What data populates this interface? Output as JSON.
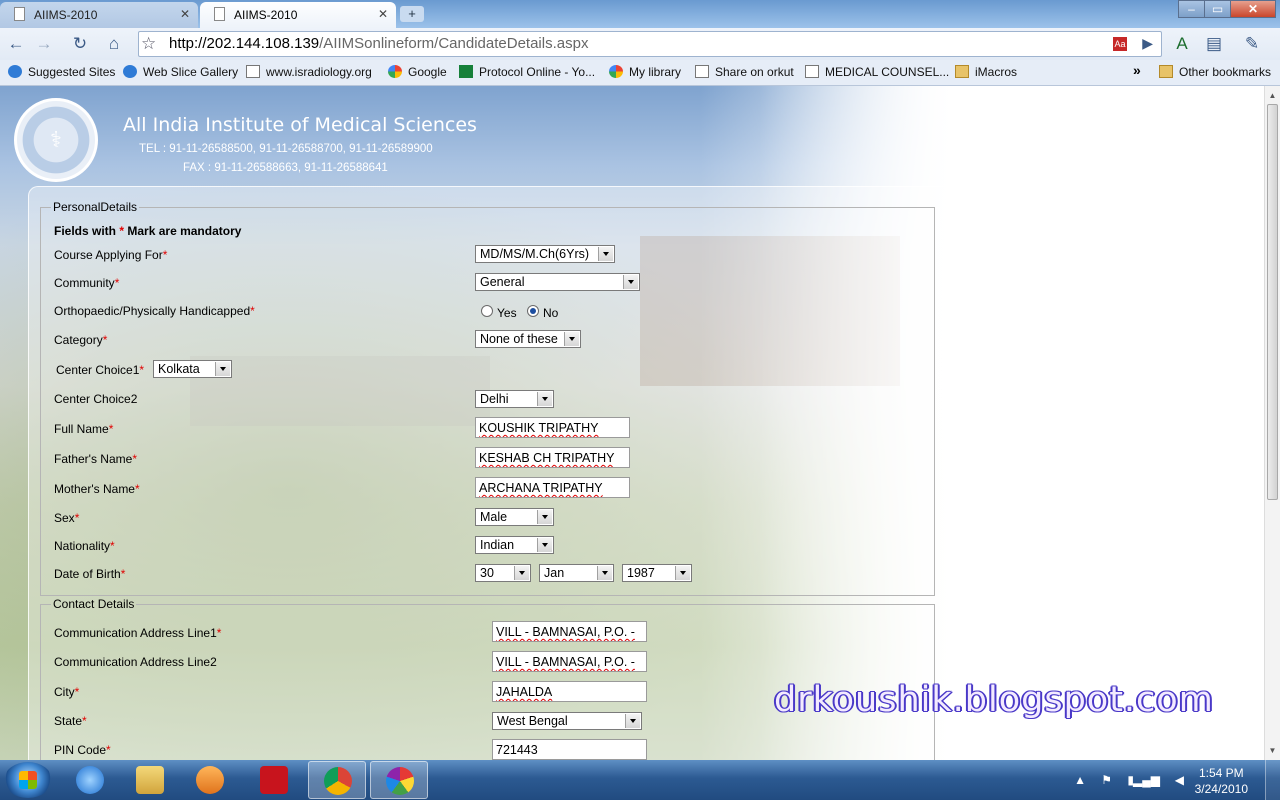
{
  "browser": {
    "tabs": [
      {
        "label": "AIIMS-2010",
        "active": false
      },
      {
        "label": "AIIMS-2010",
        "active": true
      }
    ],
    "window_buttons": {
      "minimize": "‒",
      "maximize": "▭",
      "close": "✕"
    },
    "url_host": "http://202.144.108.139",
    "url_path": "/AIIMSonlineform/CandidateDetails.aspx",
    "bookmarks": [
      {
        "label": "Suggested Sites",
        "icon": "ie-icon"
      },
      {
        "label": "Web Slice Gallery",
        "icon": "ie-icon"
      },
      {
        "label": "www.isradiology.org",
        "icon": "page-icon"
      },
      {
        "label": "Google",
        "icon": "google-icon"
      },
      {
        "label": "Protocol Online - Yo...",
        "icon": "protocol-icon"
      },
      {
        "label": "My library",
        "icon": "google-icon"
      },
      {
        "label": "Share on orkut",
        "icon": "page-icon"
      },
      {
        "label": "MEDICAL COUNSEL...",
        "icon": "page-icon"
      },
      {
        "label": "iMacros",
        "icon": "folder-icon"
      }
    ],
    "more_bookmarks": "»",
    "other_bookmarks": "Other bookmarks"
  },
  "header": {
    "institute": "All India Institute of Medical Sciences",
    "tel": "TEL : 91-11-26588500, 91-11-26588700, 91-11-26589900",
    "fax": "FAX : 91-11-26588663, 91-11-26588641"
  },
  "personal": {
    "legend": "PersonalDetails",
    "mandatory_note_prefix": "Fields with",
    "mandatory_note_star": "*",
    "mandatory_note_suffix": "Mark are mandatory",
    "req": "*",
    "course_label": "Course Applying For",
    "course_value": "MD/MS/M.Ch(6Yrs)",
    "community_label": "Community",
    "community_value": "General",
    "handicapped_label": "Orthopaedic/Physically Handicapped",
    "handicapped_yes": "Yes",
    "handicapped_no": "No",
    "handicapped_selected": "No",
    "category_label": "Category",
    "category_value": "None of these",
    "center1_label": "Center Choice1",
    "center1_value": "Kolkata",
    "center2_label": "Center Choice2",
    "center2_value": "Delhi",
    "fullname_label": "Full Name",
    "fullname_value": "KOUSHIK TRIPATHY",
    "father_label": "Father's Name",
    "father_value": "KESHAB CH TRIPATHY",
    "mother_label": "Mother's Name",
    "mother_value": "ARCHANA TRIPATHY",
    "sex_label": "Sex",
    "sex_value": "Male",
    "nationality_label": "Nationality",
    "nationality_value": "Indian",
    "dob_label": "Date of Birth",
    "dob_day": "30",
    "dob_month": "Jan",
    "dob_year": "1987"
  },
  "contact": {
    "legend": "Contact Details",
    "addr1_label": "Communication Address Line1",
    "addr1_value": "VILL - BAMNASAI, P.O. -",
    "addr2_label": "Communication Address Line2",
    "addr2_value": "VILL - BAMNASAI, P.O. -",
    "city_label": "City",
    "city_value": "JAHALDA",
    "state_label": "State",
    "state_value": "West Bengal",
    "pin_label": "PIN Code",
    "pin_value": "721443"
  },
  "watermark": "drkoushik.blogspot.com",
  "taskbar": {
    "apps": [
      "internet-explorer-icon",
      "windows-explorer-icon",
      "media-player-icon",
      "adobe-reader-icon",
      "chrome-icon",
      "picasa-icon"
    ],
    "clock_time": "1:54 PM",
    "clock_date": "3/24/2010"
  }
}
